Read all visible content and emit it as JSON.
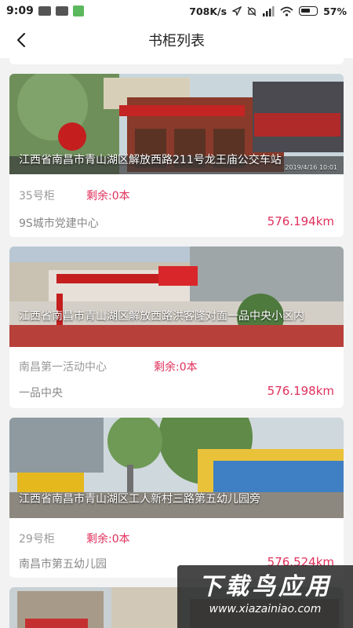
{
  "status_bar": {
    "time": "9:09",
    "speed": "708K/s",
    "battery": "57%"
  },
  "nav": {
    "title": "书柜列表"
  },
  "cards": [
    {
      "address": "江西省南昌市青山湖区解放西路211号龙王庙公交车站",
      "photo_date": "2019/4/16 10:01",
      "cabinet": "35号柜",
      "remaining": "剩余:0本",
      "org": "9S城市党建中心",
      "distance": "576.194km"
    },
    {
      "address": "江西省南昌市青山湖区解放西路洪客隆对面一品中央小区内",
      "cabinet": "南昌第一活动中心",
      "remaining": "剩余:0本",
      "org": "一品中央",
      "distance": "576.198km"
    },
    {
      "address": "江西省南昌市青山湖区工人新村三路第五幼儿园旁",
      "cabinet": "29号柜",
      "remaining": "剩余:0本",
      "org": "南昌市第五幼儿园",
      "distance": "576.524km"
    }
  ],
  "watermark": {
    "big": "下载鸟应用",
    "small": "www.xiazainiao.com"
  }
}
